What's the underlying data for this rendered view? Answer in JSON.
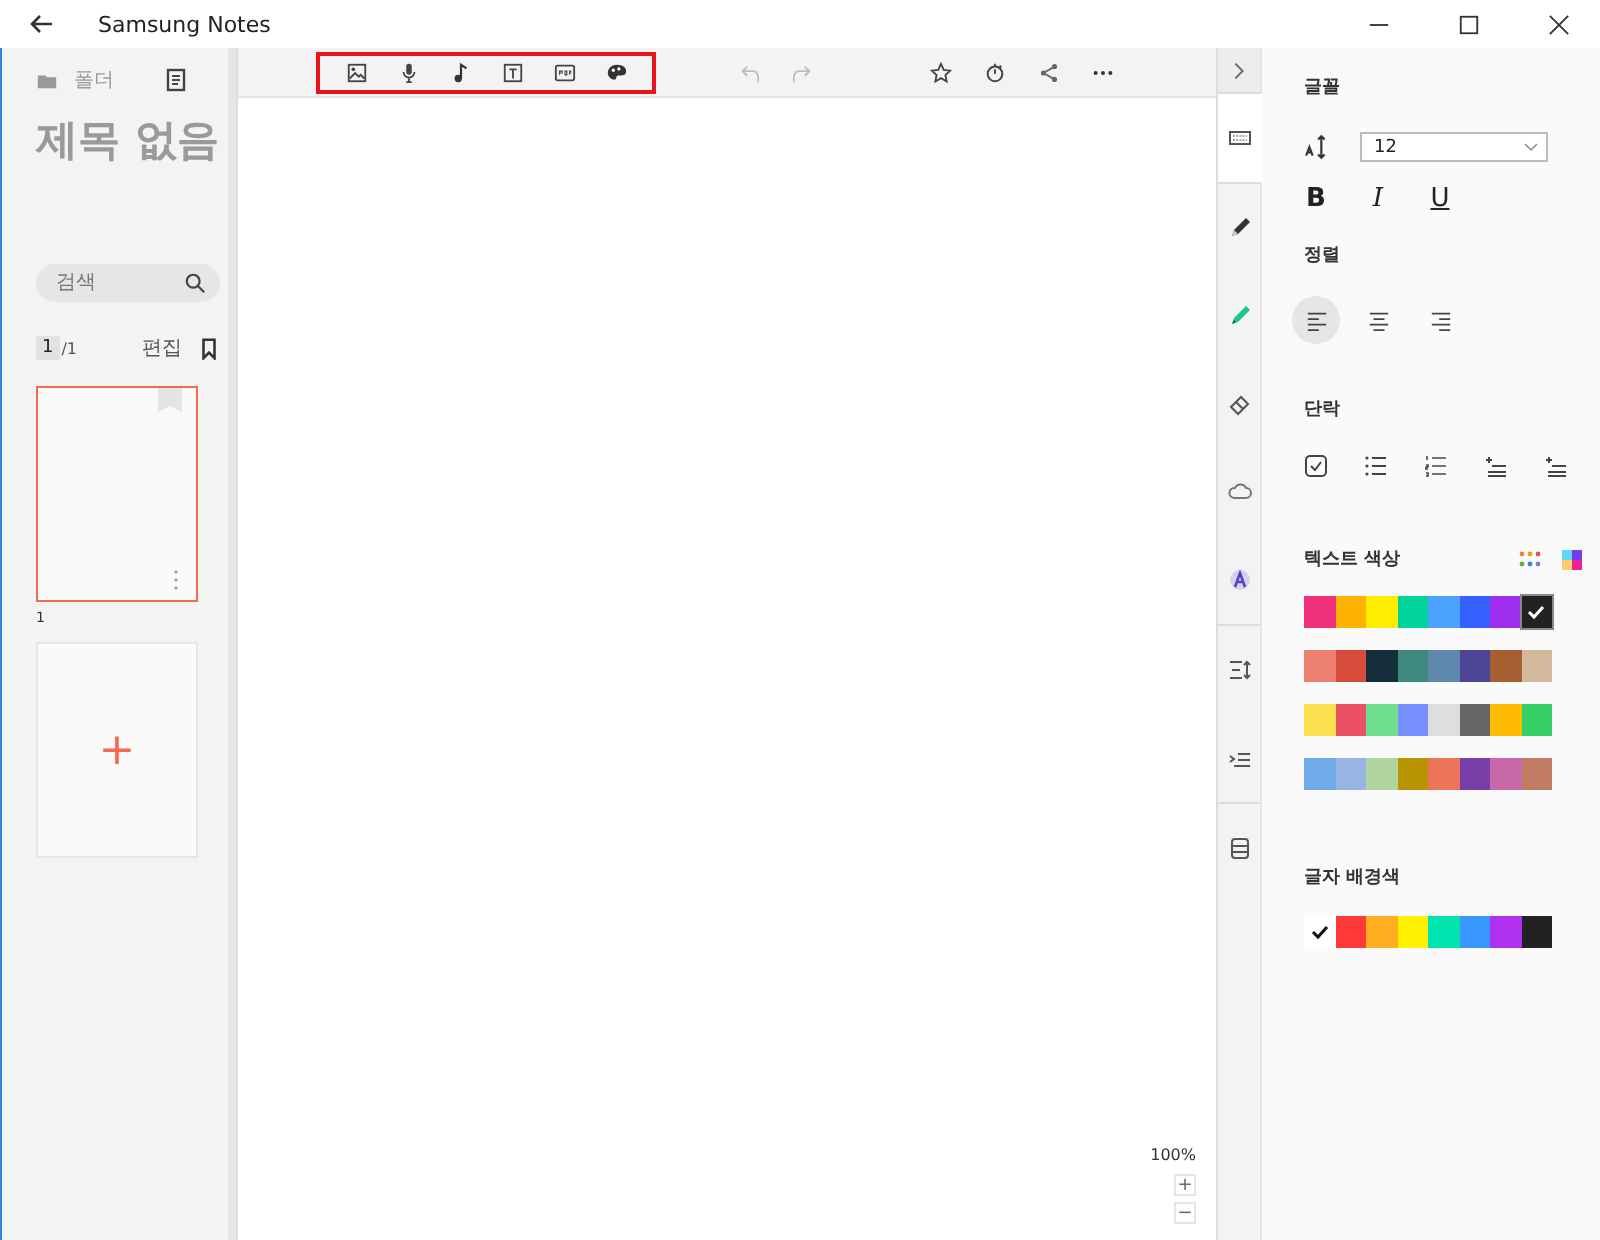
{
  "window": {
    "title": "Samsung Notes"
  },
  "sidebar": {
    "folder": "폴더",
    "note_title": "제목 없음",
    "search": {
      "placeholder": "검색"
    },
    "page_current": "1",
    "page_total": "/1",
    "edit": "편집",
    "pages": [
      {
        "label": "1",
        "selected": true
      }
    ],
    "add_page": "+"
  },
  "toolbar": {
    "insert_outlined": true,
    "insert_tools": [
      {
        "kind": "image"
      },
      {
        "kind": "voice"
      },
      {
        "kind": "music"
      },
      {
        "kind": "textbox"
      },
      {
        "kind": "pdf"
      },
      {
        "kind": "palette"
      }
    ],
    "history": [
      {
        "kind": "undo",
        "disabled": true
      },
      {
        "kind": "redo",
        "disabled": true
      }
    ],
    "actions": [
      {
        "kind": "star"
      },
      {
        "kind": "timer"
      },
      {
        "kind": "share"
      },
      {
        "kind": "more"
      }
    ]
  },
  "zoom": {
    "reading": "100%",
    "plus": "+",
    "minus": "−"
  },
  "rail": [
    {
      "kind": "keyboard",
      "selected": true
    },
    {
      "kind": "pen",
      "selected": false
    },
    {
      "kind": "highlighter",
      "selected": false
    },
    {
      "kind": "eraser",
      "selected": false
    },
    {
      "kind": "lasso",
      "selected": false
    },
    {
      "kind": "textstyle",
      "selected": false
    },
    {
      "kind": "spacing",
      "selected": false
    },
    {
      "kind": "indent",
      "selected": false
    },
    {
      "kind": "page",
      "selected": false
    }
  ],
  "format": {
    "font_heading": "글꼴",
    "font_size": "12",
    "styles": [
      "B",
      "I",
      "U"
    ],
    "align_heading": "정렬",
    "alignments": [
      {
        "kind": "left",
        "selected": true
      },
      {
        "kind": "center",
        "selected": false
      },
      {
        "kind": "right",
        "selected": false
      }
    ],
    "paragraph_heading": "단락",
    "paragraph_tools": [
      {
        "kind": "checklist"
      },
      {
        "kind": "bullets"
      },
      {
        "kind": "numbers"
      },
      {
        "kind": "indent"
      },
      {
        "kind": "outdent"
      }
    ],
    "text_color_heading": "텍스트 색상",
    "text_colors": [
      [
        {
          "color": "#f0307a",
          "selected": false
        },
        {
          "color": "#ffb300",
          "selected": false
        },
        {
          "color": "#ffee00",
          "selected": false
        },
        {
          "color": "#00d49a",
          "selected": false
        },
        {
          "color": "#4aa3ff",
          "selected": false
        },
        {
          "color": "#3460ff",
          "selected": false
        },
        {
          "color": "#a030f0",
          "selected": false
        },
        {
          "color": "#222222",
          "selected": true
        }
      ],
      [
        {
          "color": "#ee8070",
          "selected": false
        },
        {
          "color": "#d84c3c",
          "selected": false
        },
        {
          "color": "#15303c",
          "selected": false
        },
        {
          "color": "#3f8880",
          "selected": false
        },
        {
          "color": "#5f88b0",
          "selected": false
        },
        {
          "color": "#4c4495",
          "selected": false
        },
        {
          "color": "#a55f30",
          "selected": false
        },
        {
          "color": "#d4b89e",
          "selected": false
        }
      ],
      [
        {
          "color": "#fce050",
          "selected": false
        },
        {
          "color": "#ec5064",
          "selected": false
        },
        {
          "color": "#70e090",
          "selected": false
        },
        {
          "color": "#7890ff",
          "selected": false
        },
        {
          "color": "#dedede",
          "selected": false
        },
        {
          "color": "#666666",
          "selected": false
        },
        {
          "color": "#ffbb00",
          "selected": false
        },
        {
          "color": "#36d068",
          "selected": false
        }
      ],
      [
        {
          "color": "#70aae8",
          "selected": false
        },
        {
          "color": "#98b4e4",
          "selected": false
        },
        {
          "color": "#b0d4a0",
          "selected": false
        },
        {
          "color": "#b89400",
          "selected": false
        },
        {
          "color": "#ec7458",
          "selected": false
        },
        {
          "color": "#7a3ea8",
          "selected": false
        },
        {
          "color": "#c868a8",
          "selected": false
        },
        {
          "color": "#c07c64",
          "selected": false
        }
      ]
    ],
    "background_color_heading": "글자 배경색",
    "background_colors": [
      {
        "color": "#ffffff",
        "selected": true
      },
      {
        "color": "#ff3838",
        "selected": false
      },
      {
        "color": "#ffae20",
        "selected": false
      },
      {
        "color": "#fff000",
        "selected": false
      },
      {
        "color": "#00e4b0",
        "selected": false
      },
      {
        "color": "#3898ff",
        "selected": false
      },
      {
        "color": "#b030f0",
        "selected": false
      },
      {
        "color": "#222222",
        "selected": false
      }
    ]
  }
}
